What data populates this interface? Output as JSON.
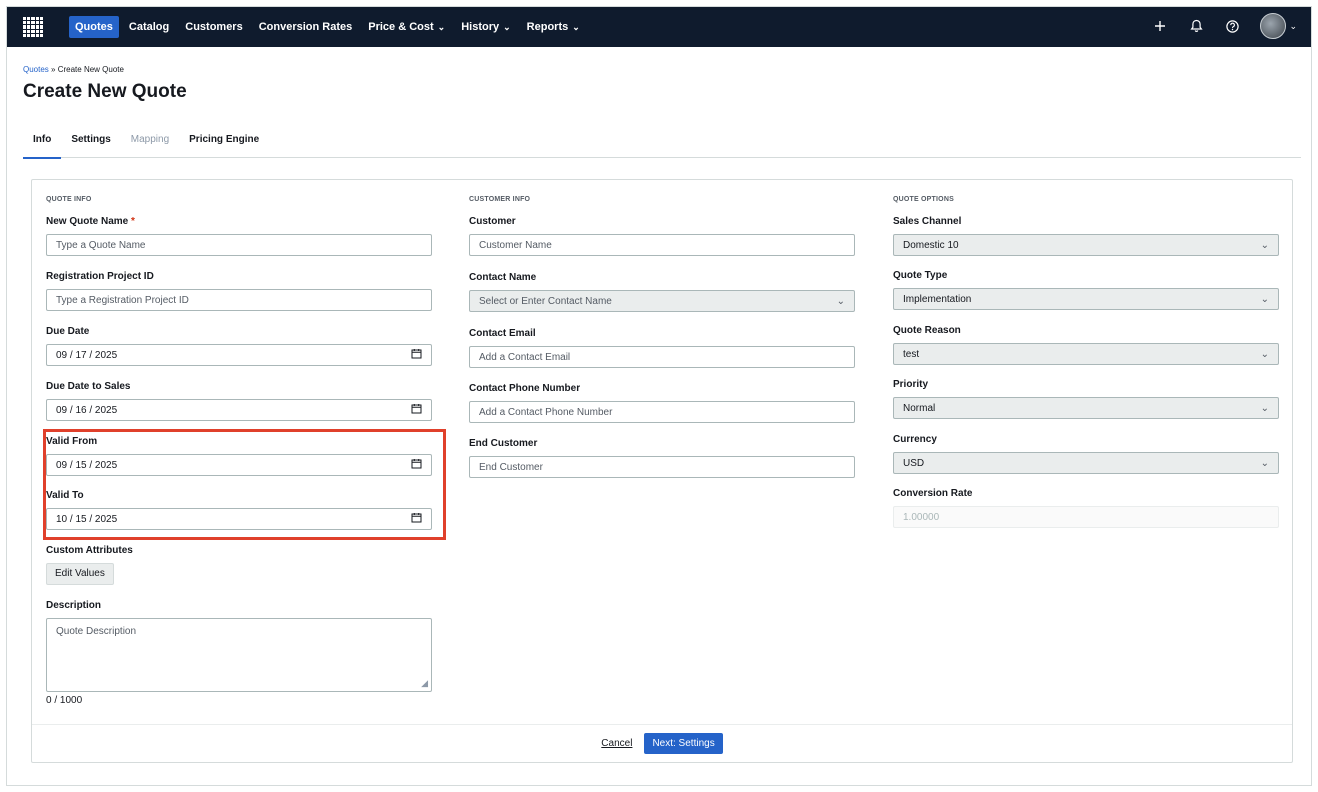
{
  "nav": {
    "items": [
      {
        "label": "Quotes",
        "active": true,
        "dropdown": false
      },
      {
        "label": "Catalog",
        "active": false,
        "dropdown": false
      },
      {
        "label": "Customers",
        "active": false,
        "dropdown": false
      },
      {
        "label": "Conversion Rates",
        "active": false,
        "dropdown": false
      },
      {
        "label": "Price & Cost",
        "active": false,
        "dropdown": true
      },
      {
        "label": "History",
        "active": false,
        "dropdown": true
      },
      {
        "label": "Reports",
        "active": false,
        "dropdown": true
      }
    ],
    "icons": [
      "plus-icon",
      "bell-icon",
      "help-icon",
      "avatar"
    ],
    "accent_color": "#2563c9",
    "bg_color": "#0f1b2d"
  },
  "breadcrumb": {
    "root": "Quotes",
    "separator": "»",
    "current": "Create New Quote"
  },
  "page_title": "Create New Quote",
  "tabs": [
    {
      "label": "Info",
      "active": true,
      "disabled": false
    },
    {
      "label": "Settings",
      "active": false,
      "disabled": false
    },
    {
      "label": "Mapping",
      "active": false,
      "disabled": true
    },
    {
      "label": "Pricing Engine",
      "active": false,
      "disabled": false
    }
  ],
  "quote_info": {
    "heading": "QUOTE INFO",
    "name": {
      "label": "New Quote Name",
      "required": "*",
      "placeholder": "Type a Quote Name"
    },
    "registration": {
      "label": "Registration Project ID",
      "placeholder": "Type a Registration Project ID"
    },
    "due_date": {
      "label": "Due Date",
      "value": "09 / 17 / 2025"
    },
    "due_date_sales": {
      "label": "Due Date to Sales",
      "value": "09 / 16 / 2025"
    },
    "valid_from": {
      "label": "Valid From",
      "value": "09 / 15 / 2025"
    },
    "valid_to": {
      "label": "Valid To",
      "value": "10 / 15 / 2025"
    },
    "custom_attributes": {
      "label": "Custom Attributes",
      "button": "Edit Values"
    },
    "description": {
      "label": "Description",
      "placeholder": "Quote Description",
      "counter": "0 / 1000"
    }
  },
  "customer_info": {
    "heading": "CUSTOMER INFO",
    "customer": {
      "label": "Customer",
      "placeholder": "Customer Name"
    },
    "contact_name": {
      "label": "Contact Name",
      "placeholder": "Select or Enter Contact Name"
    },
    "contact_email": {
      "label": "Contact Email",
      "placeholder": "Add a Contact Email"
    },
    "contact_phone": {
      "label": "Contact Phone Number",
      "placeholder": "Add a Contact Phone Number"
    },
    "end_customer": {
      "label": "End Customer",
      "placeholder": "End Customer"
    }
  },
  "quote_options": {
    "heading": "QUOTE OPTIONS",
    "sales_channel": {
      "label": "Sales Channel",
      "value": "Domestic 10"
    },
    "quote_type": {
      "label": "Quote Type",
      "value": "Implementation"
    },
    "quote_reason": {
      "label": "Quote Reason",
      "value": "test"
    },
    "priority": {
      "label": "Priority",
      "value": "Normal"
    },
    "currency": {
      "label": "Currency",
      "value": "USD"
    },
    "conversion_rate": {
      "label": "Conversion Rate",
      "value": "1.00000"
    }
  },
  "footer": {
    "cancel": "Cancel",
    "next": "Next: Settings"
  },
  "highlight_color": "#e0402b"
}
